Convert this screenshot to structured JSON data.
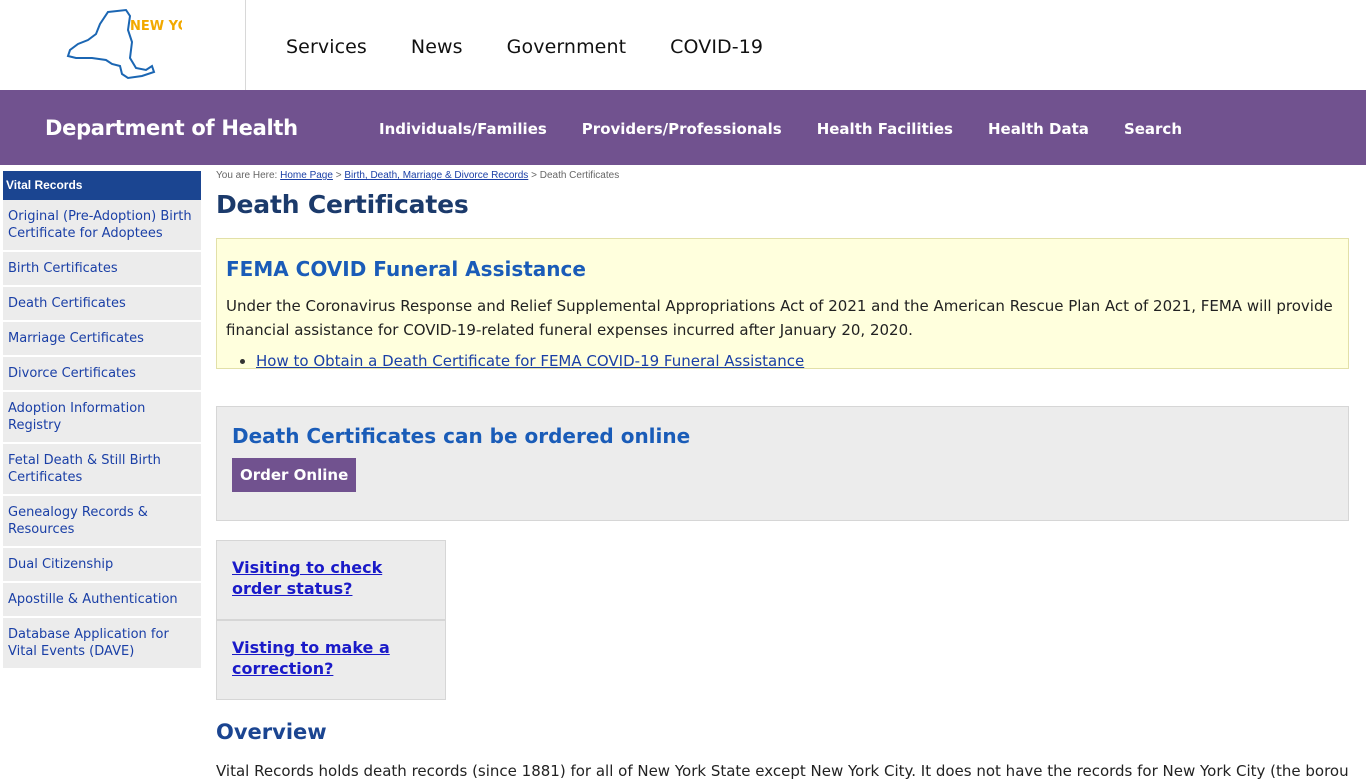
{
  "state": {
    "logo_text": "NEW YORK STATE",
    "nav": [
      "Services",
      "News",
      "Government",
      "COVID-19"
    ]
  },
  "agency": {
    "title": "Department of Health",
    "nav": [
      "Individuals/Families",
      "Providers/Professionals",
      "Health Facilities",
      "Health Data",
      "Search"
    ]
  },
  "sidebar": {
    "heading": "Vital Records",
    "items": [
      "Original (Pre-Adoption) Birth Certificate for Adoptees",
      "Birth Certificates",
      "Death Certificates",
      "Marriage Certificates",
      "Divorce Certificates",
      "Adoption Information Registry",
      "Fetal Death & Still Birth Certificates",
      "Genealogy Records & Resources",
      "Dual Citizenship",
      "Apostille & Authentication",
      "Database Application for Vital Events (DAVE)"
    ]
  },
  "breadcrumb": {
    "prefix": "You are Here:",
    "links": [
      "Home Page",
      "Birth, Death, Marriage & Divorce Records"
    ],
    "current": "Death Certificates"
  },
  "page_title": "Death Certificates",
  "fema": {
    "title": "FEMA COVID Funeral Assistance",
    "text": "Under the Coronavirus Response and Relief Supplemental Appropriations Act of 2021 and the American Rescue Plan Act of 2021, FEMA will provide financial assistance for COVID-19-related funeral expenses incurred after January 20, 2020.",
    "link": "How to Obtain a Death Certificate for FEMA COVID-19 Funeral Assistance"
  },
  "order": {
    "title": "Death Certificates can be ordered online",
    "button": "Order Online"
  },
  "visit_links": [
    "Visiting to check order status?",
    "Visting to make a correction?"
  ],
  "overview": {
    "title": "Overview",
    "text": "Vital Records holds death records (since 1881) for all of New York State except New York City. It does not have the records for New York City (the boroughs of"
  },
  "colors": {
    "purple": "#71528f",
    "sidebar_head": "#1b4591",
    "fema_bg": "#ffffdd",
    "logo_blue": "#1b66b3",
    "logo_gold": "#f2a900"
  }
}
